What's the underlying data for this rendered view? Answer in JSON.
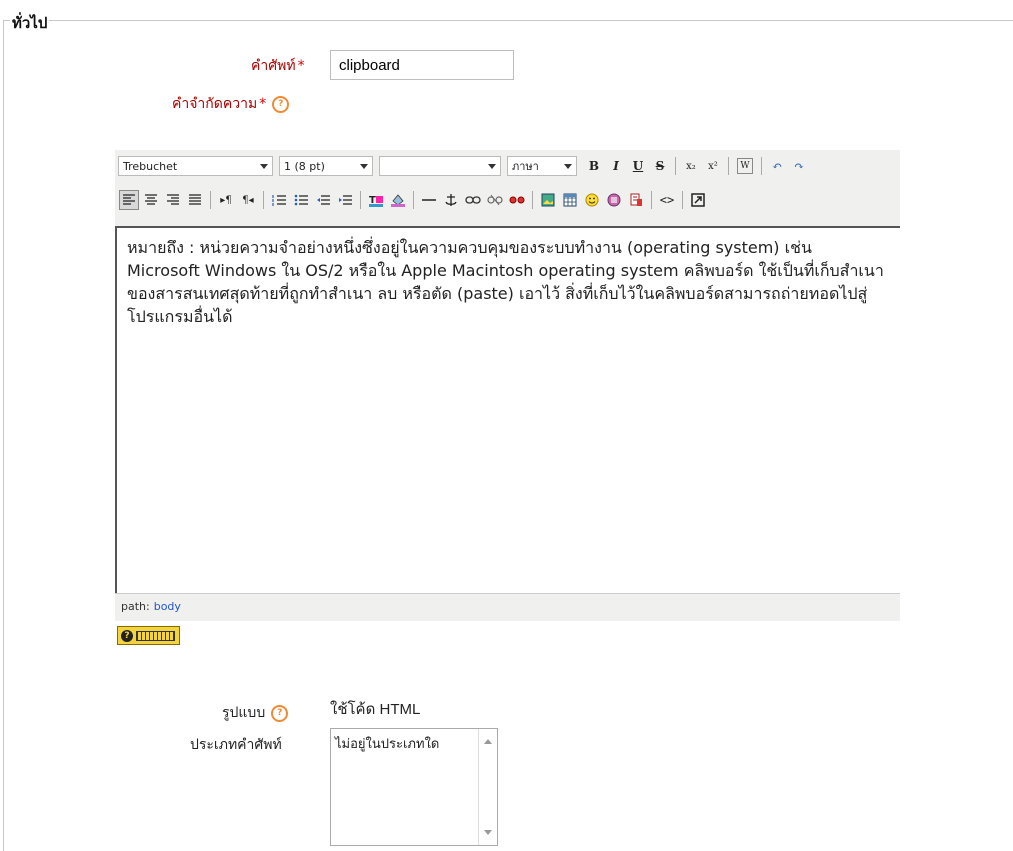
{
  "fieldset": {
    "legend": "ทั่วไป"
  },
  "form": {
    "concept_label": "คำศัพท์",
    "concept_value": "clipboard",
    "definition_label": "คำจำกัดความ",
    "required_mark": "*",
    "help_icon": "help-icon",
    "format_label": "รูปแบบ",
    "format_value": "ใช้โค้ด HTML",
    "category_label": "ประเภทคำศัพท์",
    "category_options": [
      "ไม่อยู่ในประเภทใด"
    ]
  },
  "editor": {
    "font_family": "Trebuchet",
    "font_size": "1 (8 pt)",
    "style": "",
    "language": "ภาษา",
    "toolbar_row1": [
      "B",
      "I",
      "U",
      "S",
      "x₂",
      "x²",
      "W",
      "↶",
      "↷"
    ],
    "content": "หมายถึง : หน่วยความจำอย่างหนึ่งซึ่งอยู่ในความควบคุมของระบบทำงาน (operating system) เช่น Microsoft Windows ใน OS/2 หรือใน Apple Macintosh operating system คลิพบอร์ด ใช้เป็นที่เก็บสำเนาของสารสนเทศสุดท้ายที่ถูกทำสำเนา ลบ หรือตัด (paste) เอาไว้ สิ่งที่เก็บไว้ในคลิพบอร์ดสามารถถ่ายทอดไปสู่โปรแกรมอื่นได้",
    "path_label": "path:",
    "path_value": "body"
  },
  "colors": {
    "required": "#aa0000",
    "help": "#f08a35",
    "link": "#2255cc"
  }
}
